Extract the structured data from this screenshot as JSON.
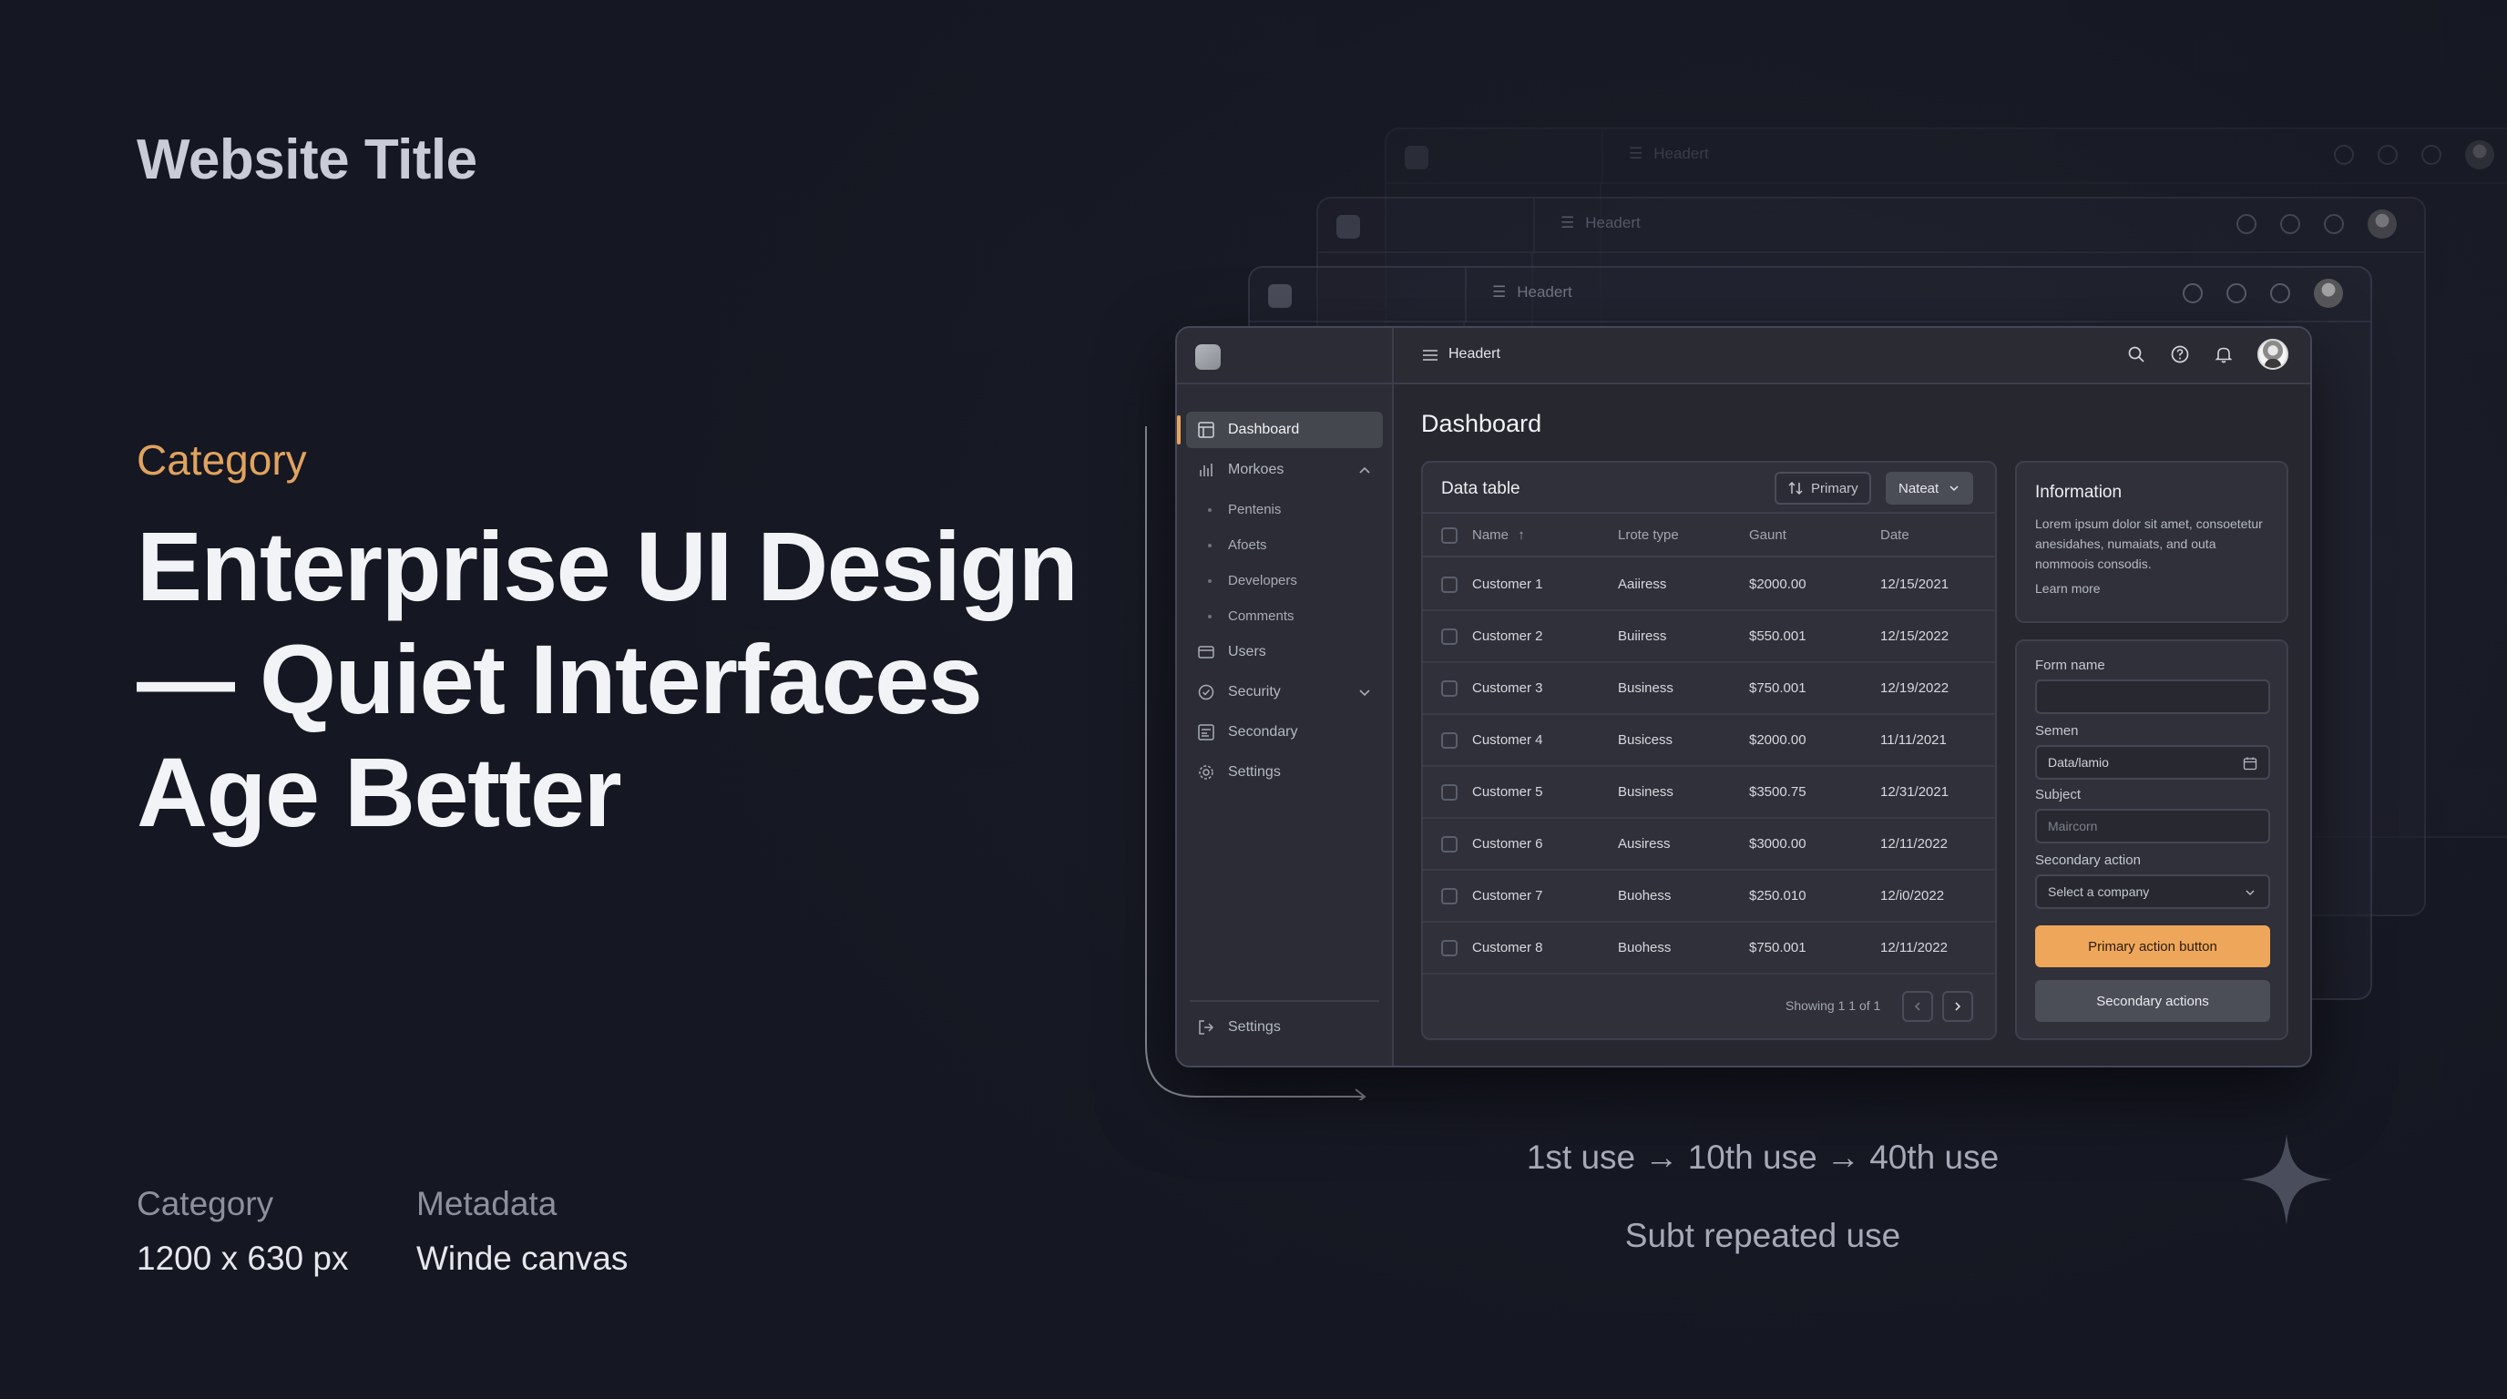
{
  "hero": {
    "website_title": "Website Title",
    "category": "Category",
    "headline_line1": "Enterprise UI Design",
    "headline_line2": "— Quiet Interfaces",
    "headline_line3": "Age Better"
  },
  "meta": {
    "col1_label": "Category",
    "col1_value": "1200 x 630 px",
    "col2_label": "Metadata",
    "col2_value": "Winde canvas"
  },
  "caption": {
    "line1": "1st use → 10th use → 40th use",
    "line2": "Subt repeated use"
  },
  "ghost_windows": [
    {
      "header": "Headert"
    },
    {
      "header": "Headert"
    },
    {
      "header": "Headert"
    }
  ],
  "app": {
    "header_title": "Headert",
    "page_title": "Dashboard",
    "sidebar": {
      "items": [
        {
          "label": "Dashboard",
          "icon": "grid-icon",
          "active": true
        },
        {
          "label": "Morkoes",
          "icon": "bar-chart-icon",
          "expanded": true
        },
        {
          "label": "Users",
          "icon": "users-icon"
        },
        {
          "label": "Security",
          "icon": "shield-icon"
        },
        {
          "label": "Secondary",
          "icon": "layout-icon"
        },
        {
          "label": "Settings",
          "icon": "gear-icon"
        }
      ],
      "subitems": [
        "Pentenis",
        "Afoets",
        "Developers",
        "Comments"
      ],
      "footer_label": "Settings"
    },
    "table": {
      "title": "Data table",
      "sort_button": "Primary",
      "filter_button": "Nateat",
      "columns": [
        "Name",
        "Lrote type",
        "Gaunt",
        "Date"
      ],
      "rows": [
        {
          "name": "Customer 1",
          "type": "Aaiiress",
          "amount": "$2000.00",
          "date": "12/15/2021"
        },
        {
          "name": "Customer 2",
          "type": "Buiiress",
          "amount": "$550.001",
          "date": "12/15/2022"
        },
        {
          "name": "Customer 3",
          "type": "Business",
          "amount": "$750.001",
          "date": "12/19/2022"
        },
        {
          "name": "Customer 4",
          "type": "Busicess",
          "amount": "$2000.00",
          "date": "11/11/2021"
        },
        {
          "name": "Customer 5",
          "type": "Business",
          "amount": "$3500.75",
          "date": "12/31/2021"
        },
        {
          "name": "Customer 6",
          "type": "Ausiress",
          "amount": "$3000.00",
          "date": "12/11/2022"
        },
        {
          "name": "Customer 7",
          "type": "Buohess",
          "amount": "$250.010",
          "date": "12/i0/2022"
        },
        {
          "name": "Customer 8",
          "type": "Buohess",
          "amount": "$750.001",
          "date": "12/11/2022"
        }
      ],
      "footer": "Showing 1 1 of 1"
    },
    "info": {
      "title": "Information",
      "body": "Lorem ipsum dolor sit amet, consoetetur anesidahes, numaiats, and outa nommoois consodis.",
      "link": "Learn more"
    },
    "form": {
      "field1_label": "Form name",
      "field1_value": "",
      "field2_label": "Semen",
      "field2_value": "Data/lamio",
      "field3_label": "Subject",
      "field3_placeholder": "Maircorn",
      "field4_label": "Secondary action",
      "field4_value": "Select a company",
      "primary_button": "Primary action button",
      "secondary_button": "Secondary actions"
    }
  },
  "colors": {
    "background": "#181a25",
    "accent": "#eea75a",
    "category": "#e0a35e"
  }
}
